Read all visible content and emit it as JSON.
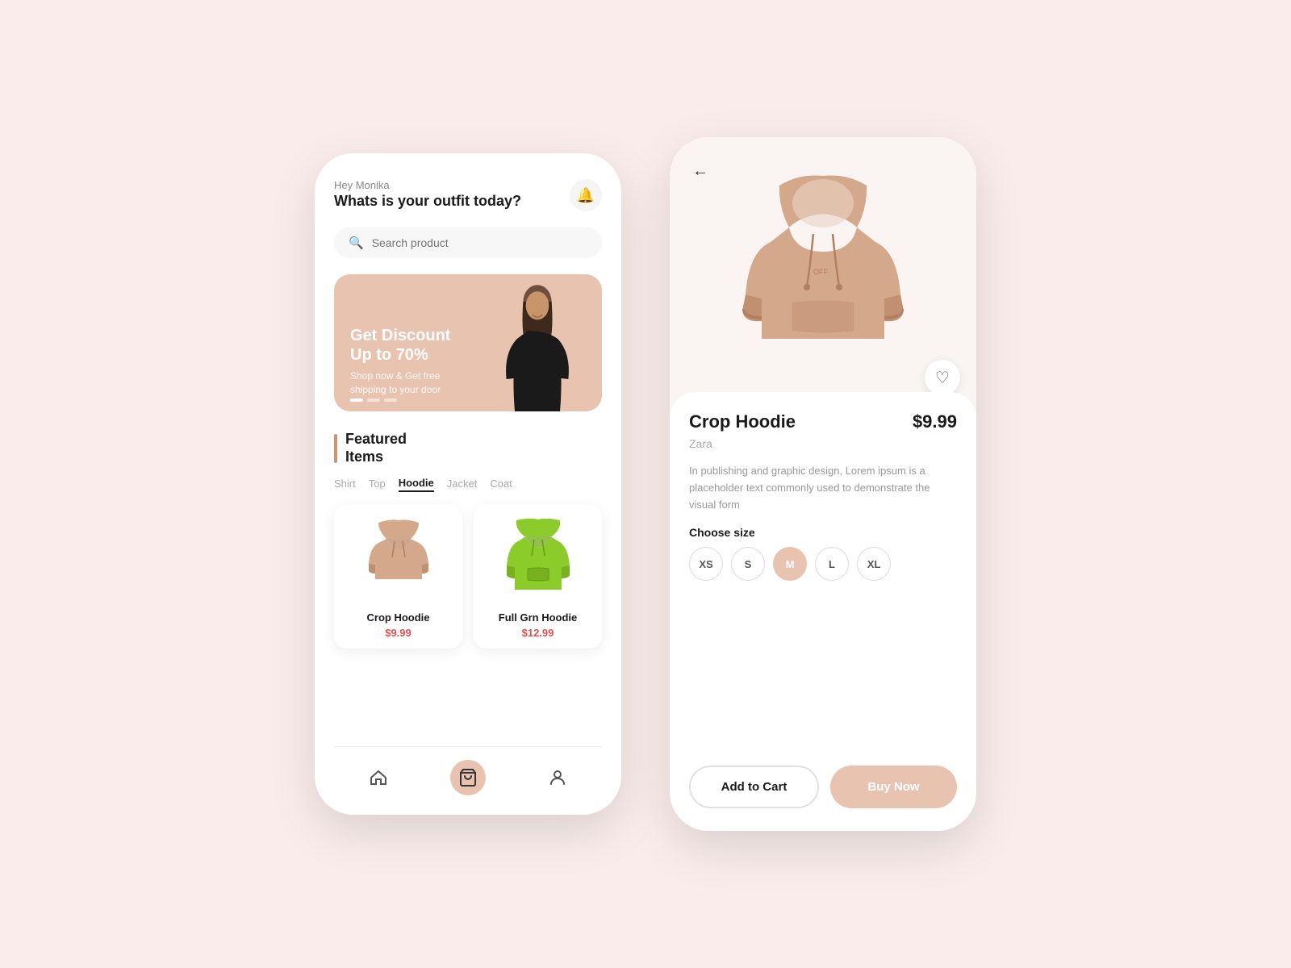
{
  "phone1": {
    "greeting_sub": "Hey Monika",
    "greeting_main": "Whats is your outfit today?",
    "search_placeholder": "Search product",
    "notification_icon": "🔔",
    "banner": {
      "title": "Get Discount\nUp to 70%",
      "subtitle": "Shop now & Get free\nshipping to your door",
      "dots": [
        true,
        false,
        false
      ]
    },
    "section_title": "Featured\nItems",
    "filter_tabs": [
      "Shirt",
      "Top",
      "Hoodie",
      "Jacket",
      "Coat"
    ],
    "active_tab": "Hoodie",
    "products": [
      {
        "name": "Crop Hoodie",
        "price": "$9.99",
        "color": "beige"
      },
      {
        "name": "Full Grn Hoodie",
        "price": "$12.99",
        "color": "green"
      }
    ],
    "nav": {
      "items": [
        "home",
        "cart",
        "profile"
      ],
      "active": "cart"
    }
  },
  "phone2": {
    "back_icon": "←",
    "wishlist_icon": "♡",
    "product_title": "Crop Hoodie",
    "product_price": "$9.99",
    "brand": "Zara",
    "description": "In publishing and graphic design, Lorem ipsum is a placeholder text commonly used to demonstrate the visual form",
    "size_label": "Choose size",
    "sizes": [
      "XS",
      "S",
      "M",
      "L",
      "XL"
    ],
    "active_size": "M",
    "carousel_dots": [
      true,
      false,
      false,
      false
    ],
    "add_to_cart": "Add to Cart",
    "buy_now": "Buy Now"
  }
}
